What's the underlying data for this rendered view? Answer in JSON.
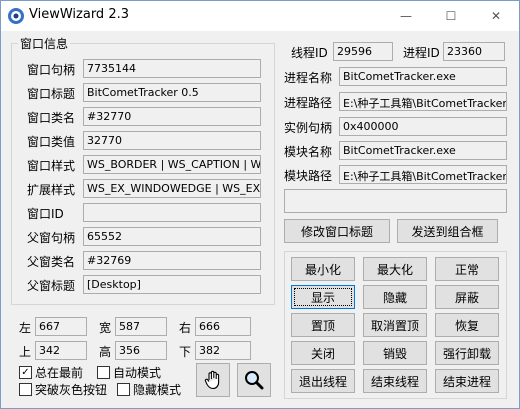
{
  "window": {
    "title": "ViewWizard 2.3",
    "minimize": "—",
    "maximize": "☐",
    "close": "✕"
  },
  "info_group": {
    "label": "窗口信息",
    "rows": [
      {
        "label": "窗口句柄",
        "value": "7735144"
      },
      {
        "label": "窗口标题",
        "value": "BitCometTracker 0.5"
      },
      {
        "label": "窗口类名",
        "value": "#32770"
      },
      {
        "label": "窗口类值",
        "value": "32770"
      },
      {
        "label": "窗口样式",
        "value": "WS_BORDER | WS_CAPTION | WS_C"
      },
      {
        "label": "扩展样式",
        "value": "WS_EX_WINDOWEDGE | WS_EX_DL"
      },
      {
        "label": "窗口ID",
        "value": ""
      },
      {
        "label": "父窗句柄",
        "value": "65552"
      },
      {
        "label": "父窗类名",
        "value": "#32769"
      },
      {
        "label": "父窗标题",
        "value": "[Desktop]"
      }
    ]
  },
  "geometry": {
    "left_label": "左",
    "left": "667",
    "width_label": "宽",
    "width": "587",
    "right_label": "右",
    "right": "666",
    "top_label": "上",
    "top": "342",
    "height_label": "高",
    "height": "356",
    "bottom_label": "下",
    "bottom": "382"
  },
  "checks": [
    {
      "label": "总在最前",
      "checked": true
    },
    {
      "label": "自动模式",
      "checked": false
    },
    {
      "label": "突破灰色按钮",
      "checked": false
    },
    {
      "label": "隐藏模式",
      "checked": false
    }
  ],
  "process": {
    "thread_id_label": "线程ID",
    "thread_id": "29596",
    "process_id_label": "进程ID",
    "process_id": "23360",
    "name_label": "进程名称",
    "name": "BitCometTracker.exe",
    "path_label": "进程路径",
    "path": "E:\\种子工具箱\\BitCometTracker_",
    "instance_label": "实例句柄",
    "instance": "0x400000",
    "module_name_label": "模块名称",
    "module_name": "BitCometTracker.exe",
    "module_path_label": "模块路径",
    "module_path": "E:\\种子工具箱\\BitCometTracker_0"
  },
  "actions": {
    "modify_title": "修改窗口标题",
    "send_combo": "发送到组合框",
    "grid": [
      [
        "最小化",
        "最大化",
        "正常"
      ],
      [
        "显示",
        "隐藏",
        "屏蔽"
      ],
      [
        "置顶",
        "取消置顶",
        "恢复"
      ],
      [
        "关闭",
        "销毁",
        "强行卸载"
      ],
      [
        "退出线程",
        "结束线程",
        "结束进程"
      ]
    ]
  }
}
